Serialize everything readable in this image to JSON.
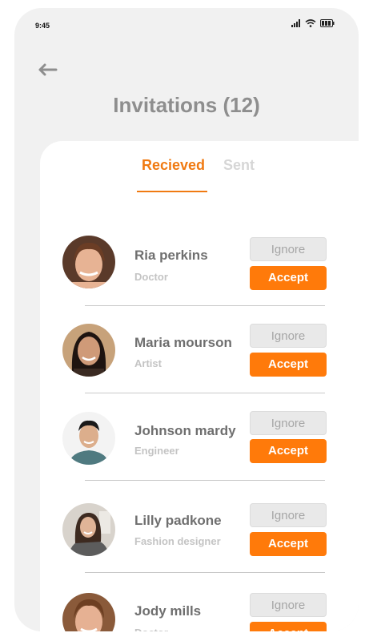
{
  "status_bar": {
    "time": "9:45"
  },
  "header": {
    "title": "Invitations (12)"
  },
  "tabs": [
    {
      "label": "Recieved",
      "active": true
    },
    {
      "label": "Sent",
      "active": false
    }
  ],
  "buttons": {
    "ignore": "Ignore",
    "accept": "Accept"
  },
  "invitations": [
    {
      "name": "Ria perkins",
      "role": "Doctor"
    },
    {
      "name": "Maria mourson",
      "role": "Artist"
    },
    {
      "name": "Johnson mardy",
      "role": "Engineer"
    },
    {
      "name": "Lilly padkone",
      "role": "Fashion designer"
    },
    {
      "name": "Jody mills",
      "role": "Doctor"
    }
  ],
  "colors": {
    "accent": "#ff7a0a",
    "background": "#f1f1f1",
    "muted": "#c4c4c4"
  }
}
